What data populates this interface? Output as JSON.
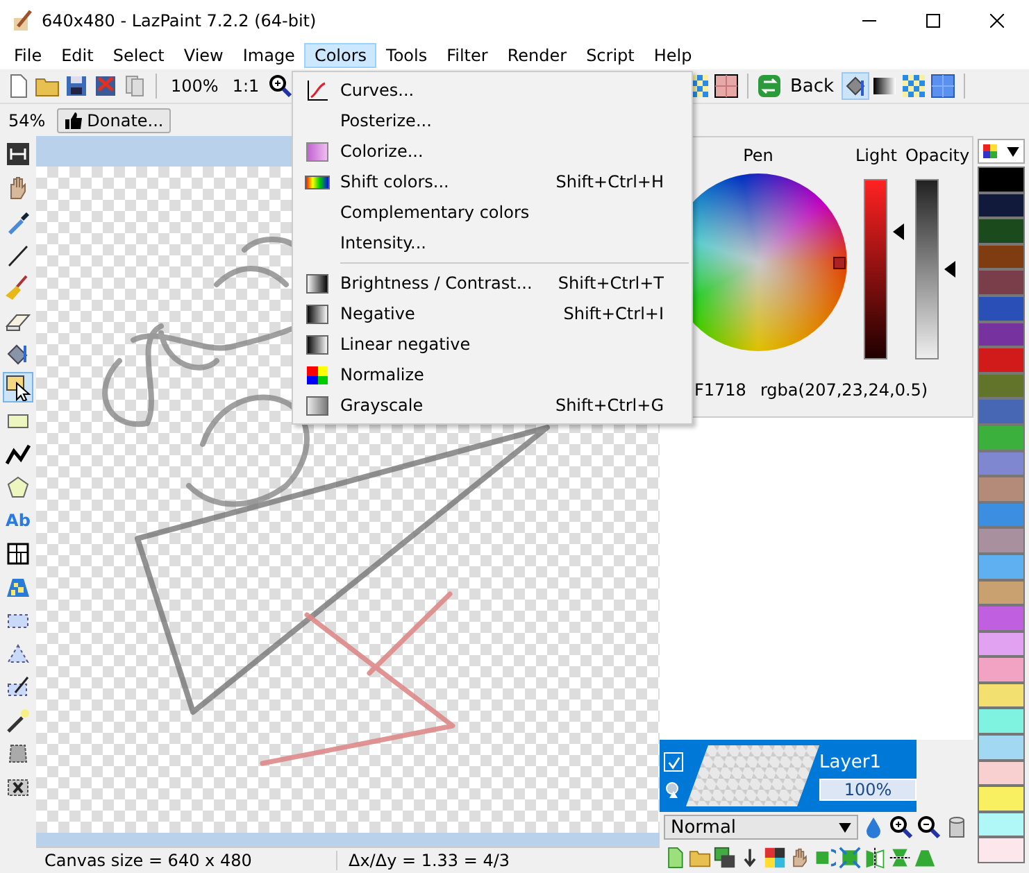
{
  "window": {
    "title": "640x480 - LazPaint 7.2.2 (64-bit)"
  },
  "menubar": [
    {
      "label": "File",
      "selected": false
    },
    {
      "label": "Edit",
      "selected": false
    },
    {
      "label": "Select",
      "selected": false
    },
    {
      "label": "View",
      "selected": false
    },
    {
      "label": "Image",
      "selected": false
    },
    {
      "label": "Colors",
      "selected": true
    },
    {
      "label": "Tools",
      "selected": false
    },
    {
      "label": "Filter",
      "selected": false
    },
    {
      "label": "Render",
      "selected": false
    },
    {
      "label": "Script",
      "selected": false
    },
    {
      "label": "Help",
      "selected": false
    }
  ],
  "toolbar": {
    "zoom": "100%",
    "actual_size": "1:1",
    "back": "Back",
    "fill_selected": true
  },
  "toolbar2": {
    "zoom": "54%",
    "donate": "Donate..."
  },
  "colors_menu": [
    {
      "kind": "item",
      "label": "Curves..."
    },
    {
      "kind": "item",
      "label": "Posterize..."
    },
    {
      "kind": "item",
      "label": "Colorize..."
    },
    {
      "kind": "item",
      "label": "Shift colors...",
      "shortcut": "Shift+Ctrl+H"
    },
    {
      "kind": "item",
      "label": "Complementary colors"
    },
    {
      "kind": "item",
      "label": "Intensity..."
    },
    {
      "kind": "separator"
    },
    {
      "kind": "item",
      "label": "Brightness / Contrast...",
      "shortcut": "Shift+Ctrl+T"
    },
    {
      "kind": "item",
      "label": "Negative",
      "shortcut": "Shift+Ctrl+I"
    },
    {
      "kind": "item",
      "label": "Linear negative"
    },
    {
      "kind": "item",
      "label": "Normalize"
    },
    {
      "kind": "item",
      "label": "Grayscale",
      "shortcut": "Shift+Ctrl+G"
    }
  ],
  "tools": [
    {
      "selected": false
    },
    {
      "selected": false
    },
    {
      "selected": false
    },
    {
      "selected": false
    },
    {
      "selected": false
    },
    {
      "selected": false
    },
    {
      "selected": false
    },
    {
      "selected": true
    },
    {
      "selected": false
    },
    {
      "selected": false
    },
    {
      "selected": false
    },
    {
      "selected": false,
      "glyph": "Ab"
    },
    {
      "selected": false
    },
    {
      "selected": false
    },
    {
      "selected": false
    },
    {
      "selected": false
    },
    {
      "selected": false
    },
    {
      "selected": false
    },
    {
      "selected": false
    },
    {
      "selected": false
    }
  ],
  "color_panel": {
    "pen_label": "Pen",
    "light_label": "Light",
    "opacity_label": "Opacity",
    "light": {
      "level": 0.71
    },
    "opacity": {
      "level": 0.5
    },
    "hex": "F1718",
    "rgba": "rgba(207,23,24,0.5)"
  },
  "palette": [
    {
      "color": "#000000"
    },
    {
      "color": "#121a3b"
    },
    {
      "color": "#1b4a1d"
    },
    {
      "color": "#7f3c10"
    },
    {
      "color": "#7a3e4a"
    },
    {
      "color": "#2a50b7"
    },
    {
      "color": "#7633a0"
    },
    {
      "color": "#d11b1b"
    },
    {
      "color": "#62732a"
    },
    {
      "color": "#4767b4"
    },
    {
      "color": "#3cb03c"
    },
    {
      "color": "#7f87d0"
    },
    {
      "color": "#b48a78"
    },
    {
      "color": "#3c8fe0"
    },
    {
      "color": "#a8909f"
    },
    {
      "color": "#5eb0f0"
    },
    {
      "color": "#c9a070"
    },
    {
      "color": "#c060e0"
    },
    {
      "color": "#e2a2f2"
    },
    {
      "color": "#f2a2c2"
    },
    {
      "color": "#f2e070"
    },
    {
      "color": "#80f2e0"
    },
    {
      "color": "#a2d8f2"
    },
    {
      "color": "#f8d0d0"
    },
    {
      "color": "#f8f060"
    },
    {
      "color": "#b0f8f8"
    },
    {
      "color": "#fce8ec"
    }
  ],
  "layer": {
    "name": "Layer1",
    "opacity": "100%",
    "visible": true
  },
  "blend_mode": "Normal",
  "status_bar": {
    "canvas_size": "Canvas size = 640 x 480",
    "ratio": "Δx/Δy = 1.33 = 4/3"
  }
}
